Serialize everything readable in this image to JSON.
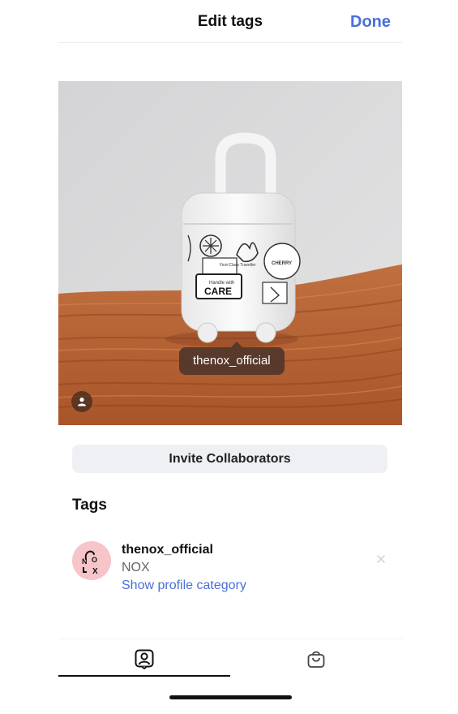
{
  "header": {
    "title": "Edit tags",
    "done_label": "Done"
  },
  "photo": {
    "tag_label": "thenox_official",
    "sticker_texts": [
      "First-Class Traveller",
      "Handle with",
      "CARE",
      "CHERRY"
    ],
    "badge_icon": "person-icon"
  },
  "invite_button_label": "Invite Collaborators",
  "tags_section": {
    "heading": "Tags",
    "items": [
      {
        "username": "thenox_official",
        "full_name": "NOX",
        "category_link": "Show profile category",
        "avatar_letters": "NOX",
        "remove_icon": "close-icon"
      }
    ]
  },
  "bottom_tabs": [
    {
      "name": "people",
      "icon": "person-square-icon",
      "selected": true
    },
    {
      "name": "products",
      "icon": "shopping-bag-icon",
      "selected": false
    }
  ],
  "colors": {
    "accent": "#4a6fd8",
    "tag_bubble": "#50362a",
    "invite_button_bg": "#eff0f3",
    "avatar_bg": "#f6c4c9"
  }
}
